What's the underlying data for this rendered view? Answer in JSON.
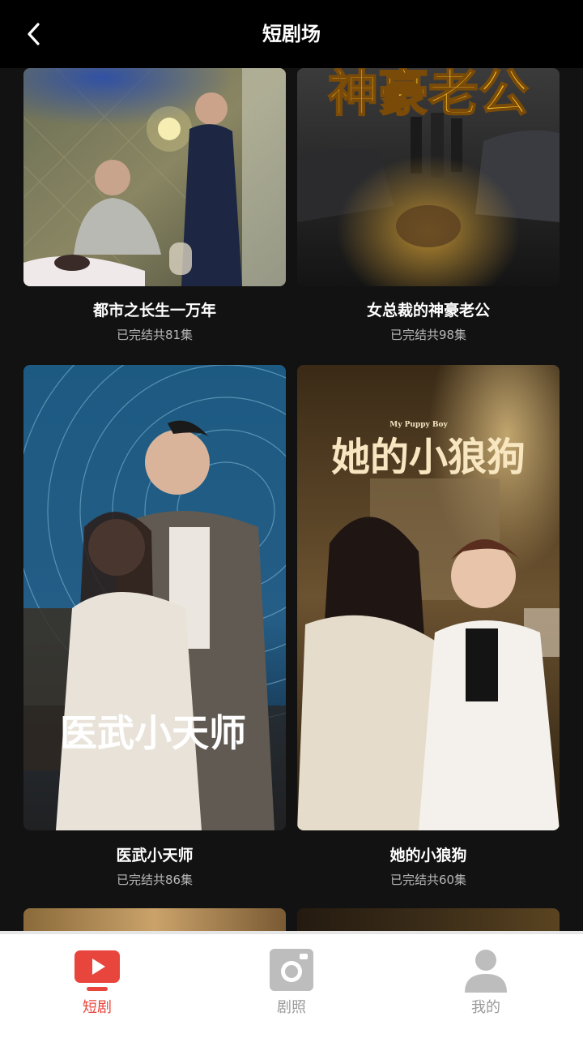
{
  "header": {
    "title": "短剧场"
  },
  "dramas": [
    {
      "title": "都市之长生一万年",
      "status": "已完结共81集",
      "poster_text": ""
    },
    {
      "title": "女总裁的神豪老公",
      "status": "已完结共98集",
      "poster_text": "神豪老公"
    },
    {
      "title": "医武小天师",
      "status": "已完结共86集",
      "poster_text": "医武小天师"
    },
    {
      "title": "她的小狼狗",
      "status": "已完结共60集",
      "poster_text": "她的小狼狗",
      "poster_subtext": "My Puppy Boy"
    }
  ],
  "tabbar": {
    "items": [
      {
        "label": "短剧",
        "icon": "play-video-icon",
        "active": true
      },
      {
        "label": "剧照",
        "icon": "camera-photo-icon",
        "active": false
      },
      {
        "label": "我的",
        "icon": "user-profile-icon",
        "active": false
      }
    ]
  },
  "colors": {
    "accent": "#e8453c",
    "background": "#121212",
    "header": "#000000",
    "tab_inactive": "#9a9a9a"
  }
}
